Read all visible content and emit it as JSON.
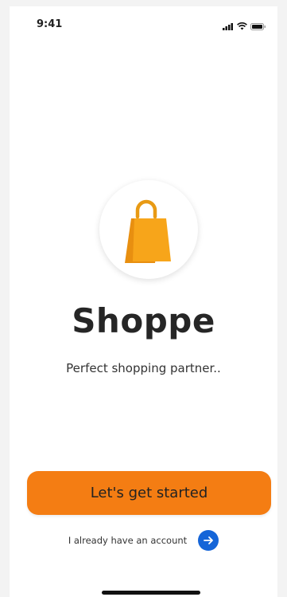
{
  "status_bar": {
    "time": "9:41",
    "icons": [
      "signal-icon",
      "wifi-icon",
      "battery-icon"
    ]
  },
  "logo": {
    "icon": "shopping-bag-icon",
    "colors": {
      "bag_front": "#f7a51a",
      "bag_back": "#e88f10",
      "handle": "#e89a14"
    }
  },
  "app": {
    "title": "Shoppe",
    "tagline": "Perfect shopping partner.."
  },
  "actions": {
    "start_label": "Let's get started",
    "account_label": "I already have an account",
    "account_icon": "arrow-right-icon"
  },
  "colors": {
    "accent": "#f47d13",
    "link_button": "#1565d8"
  }
}
